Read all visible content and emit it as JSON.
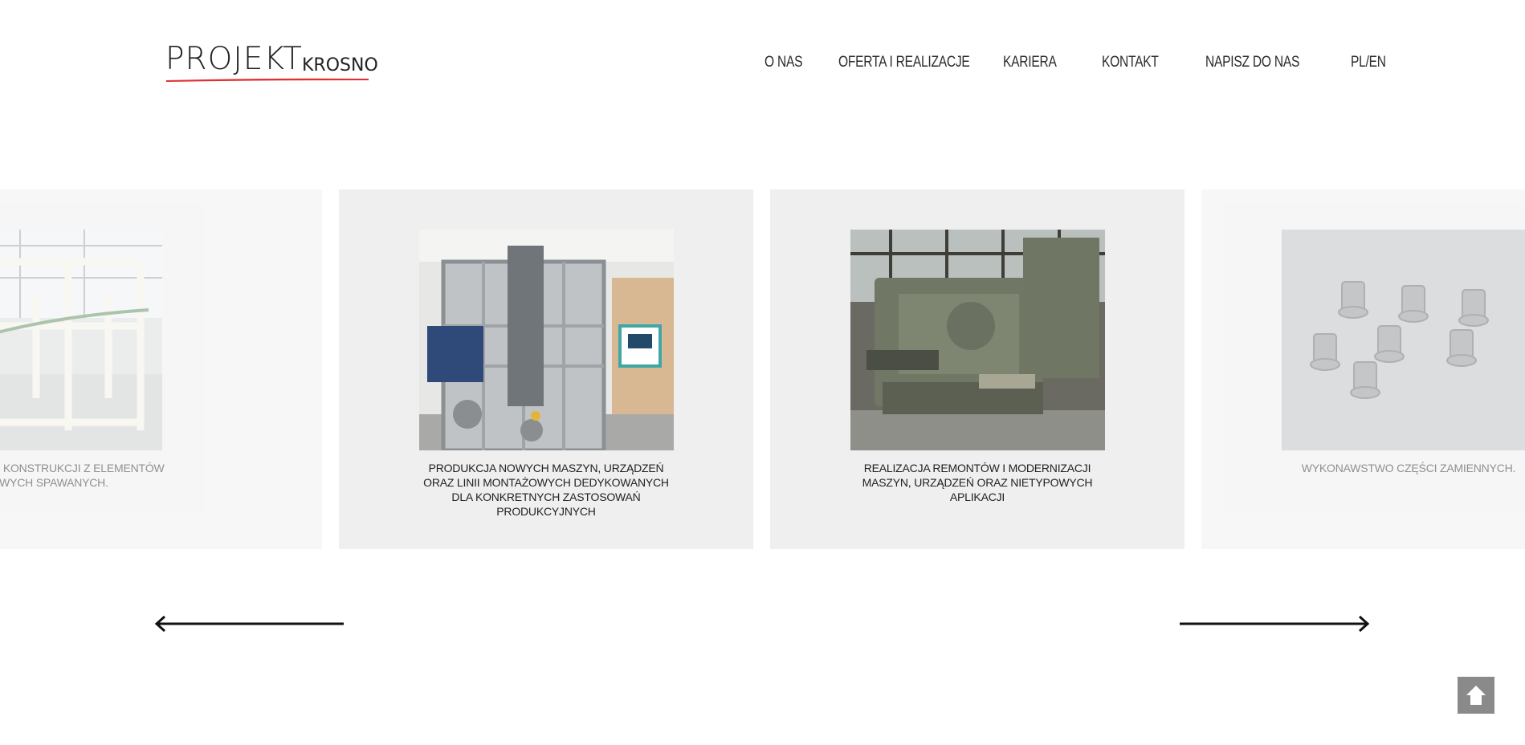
{
  "header": {
    "logo": {
      "main": "PROJEKT",
      "sub": "KROSNO",
      "accent_color": "#e03030"
    },
    "nav": [
      {
        "label": "O NAS"
      },
      {
        "label": "OFERTA I REALIZACJE"
      },
      {
        "label": "KARIERA"
      },
      {
        "label": "KONTAKT"
      },
      {
        "label": "NAPISZ DO NAS"
      },
      {
        "label": "PL/EN"
      }
    ]
  },
  "carousel": {
    "slides": [
      {
        "caption": "WYKONAWSTWO KONSTRUKCJI Z ELEMENTÓW STALOWYCH SPAWANYCH.",
        "image": "steel-frame-photo"
      },
      {
        "caption": "PRODUKCJA NOWYCH MASZYN, URZĄDZEŃ ORAZ LINII MONTAŻOWYCH DEDYKOWANYCH DLA KONKRETNYCH ZASTOSOWAŃ PRODUKCYJNYCH",
        "image": "new-machine-photo"
      },
      {
        "caption": "REALIZACJA REMONTÓW I MODERNIZACJI MASZYN, URZĄDZEŃ ORAZ NIETYPOWYCH APLIKACJI",
        "image": "lathe-machine-photo"
      },
      {
        "caption": "WYKONAWSTWO CZĘŚCI ZAMIENNYCH.",
        "image": "spare-parts-photo"
      }
    ],
    "prev_icon": "arrow-left-icon",
    "next_icon": "arrow-right-icon"
  },
  "back_to_top": {
    "icon": "arrow-up-icon"
  },
  "colors": {
    "slide_bg": "#efefef",
    "text": "#222222",
    "top_button": "#8a8a8a"
  }
}
